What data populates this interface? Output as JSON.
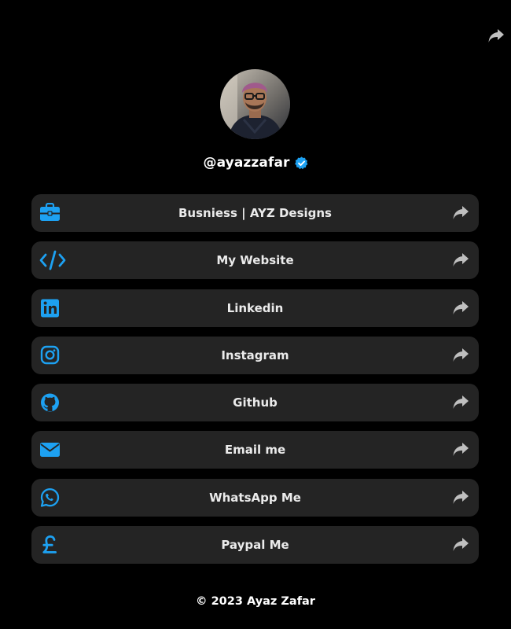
{
  "profile": {
    "handle": "@ayazzafar",
    "verified": true
  },
  "links": [
    {
      "label": "Busniess | AYZ Designs",
      "icon": "briefcase-icon"
    },
    {
      "label": "My Website",
      "icon": "code-icon"
    },
    {
      "label": "Linkedin",
      "icon": "linkedin-icon"
    },
    {
      "label": "Instagram",
      "icon": "instagram-icon"
    },
    {
      "label": "Github",
      "icon": "github-icon"
    },
    {
      "label": "Email me",
      "icon": "envelope-icon"
    },
    {
      "label": "WhatsApp Me",
      "icon": "whatsapp-icon"
    },
    {
      "label": "Paypal Me",
      "icon": "pound-icon"
    }
  ],
  "footer": {
    "text": "© 2023 Ayaz Zafar"
  },
  "colors": {
    "background": "#000000",
    "card": "#242424",
    "accent": "#1da1f2",
    "share_gray": "#bfbfbf",
    "text": "#ffffff"
  }
}
